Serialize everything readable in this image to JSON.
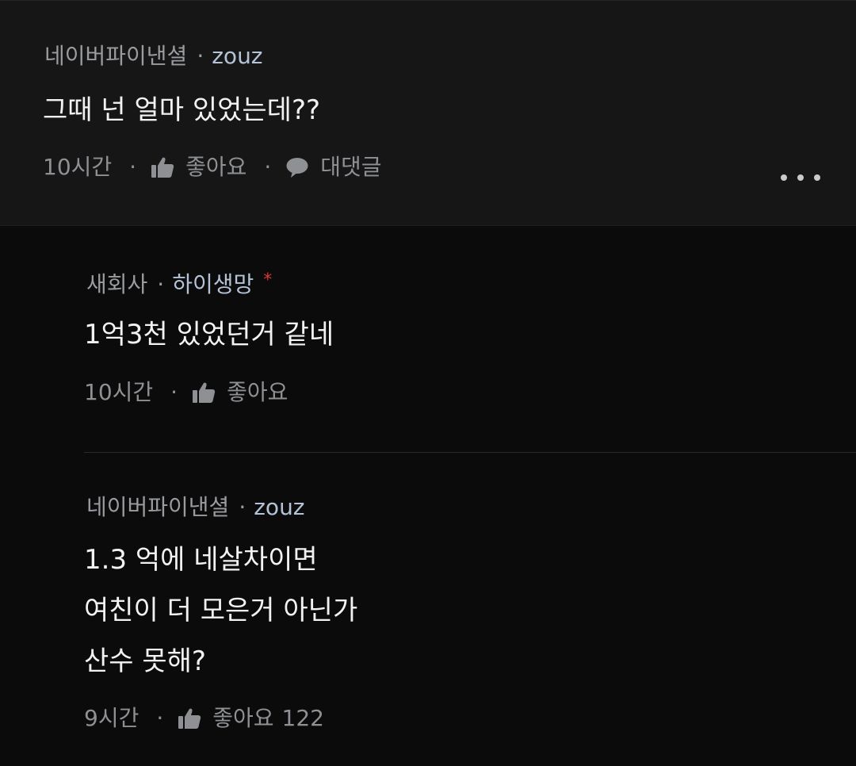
{
  "comments": [
    {
      "category": "네이버파이낸셜",
      "nickname": "zouz",
      "text": [
        "그때 넌 얼마 있었는데??"
      ],
      "time": "10시간",
      "like_label": "좋아요",
      "reply_label": "대댓글"
    },
    {
      "category": "새회사",
      "nickname": "하이생망",
      "badge": "*",
      "text": [
        "1억3천 있었던거 같네"
      ],
      "time": "10시간",
      "like_label": "좋아요"
    },
    {
      "category": "네이버파이낸셜",
      "nickname": "zouz",
      "text": [
        "1.3 억에 네살차이면",
        "여친이 더 모은거 아닌가",
        "산수 못해?"
      ],
      "time": "9시간",
      "like_label": "좋아요",
      "like_count": "122"
    }
  ],
  "separator": "·",
  "icons": {
    "like": "thumbs-up-icon",
    "reply": "speech-bubble-icon",
    "more": "more-horizontal-icon"
  },
  "colors": {
    "background": "#0b0b0c",
    "top_comment_background": "#161617",
    "nickname": "#b4c3d6",
    "badge": "#e0352e"
  }
}
